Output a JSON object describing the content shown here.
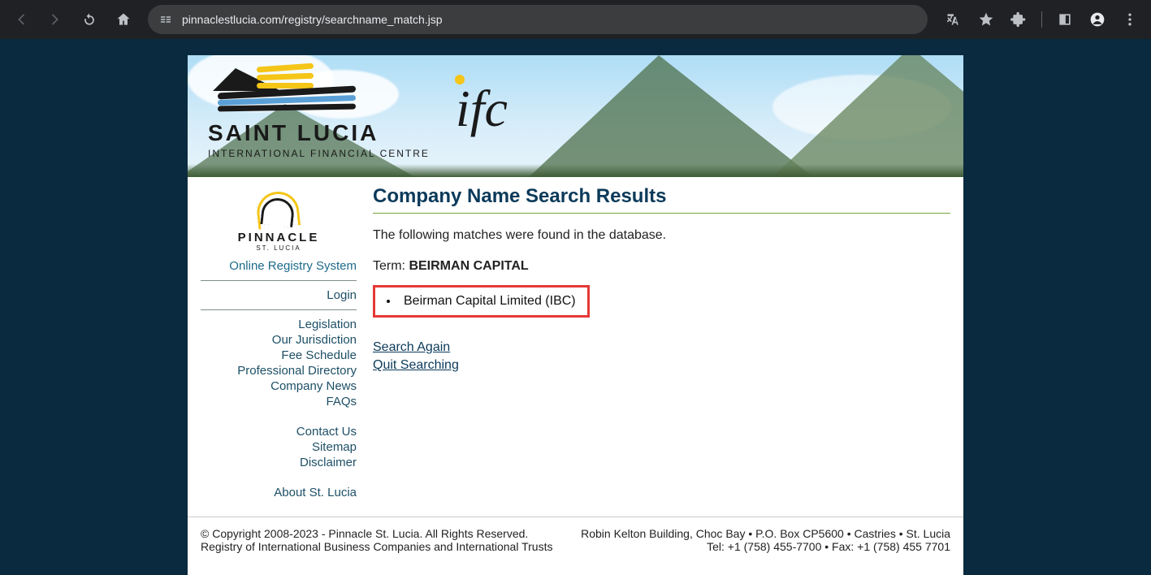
{
  "browser": {
    "url": "pinnaclestlucia.com/registry/searchname_match.jsp"
  },
  "banner": {
    "title": "SAINT LUCIA",
    "subtitle": "INTERNATIONAL FINANCIAL CENTRE",
    "ifc": "ifc"
  },
  "sidebar": {
    "logo_name": "PINNACLE",
    "logo_sub": "ST. LUCIA",
    "system_title": "Online Registry System",
    "links_auth": {
      "login": "Login"
    },
    "links_main": {
      "legislation": "Legislation",
      "jurisdiction": "Our Jurisdiction",
      "fee_schedule": "Fee Schedule",
      "directory": "Professional Directory",
      "news": "Company News",
      "faqs": "FAQs"
    },
    "links_info": {
      "contact": "Contact Us",
      "sitemap": "Sitemap",
      "disclaimer": "Disclaimer"
    },
    "links_about": {
      "about": "About St. Lucia"
    }
  },
  "main": {
    "title": "Company Name Search Results",
    "intro": "The following matches were found in the database.",
    "term_label": "Term: ",
    "term_value": "BEIRMAN CAPITAL",
    "results": [
      "Beirman Capital Limited (IBC)"
    ],
    "search_again": "Search Again",
    "quit_searching": "Quit Searching"
  },
  "footer": {
    "left_line1": "© Copyright 2008-2023 - Pinnacle St. Lucia. All Rights Reserved.",
    "left_line2": "Registry of International Business Companies and International Trusts",
    "right_line1": "Robin Kelton Building, Choc Bay • P.O. Box CP5600 • Castries • St. Lucia",
    "right_line2": "Tel: +1 (758) 455-7700 • Fax: +1 (758) 455 7701"
  }
}
